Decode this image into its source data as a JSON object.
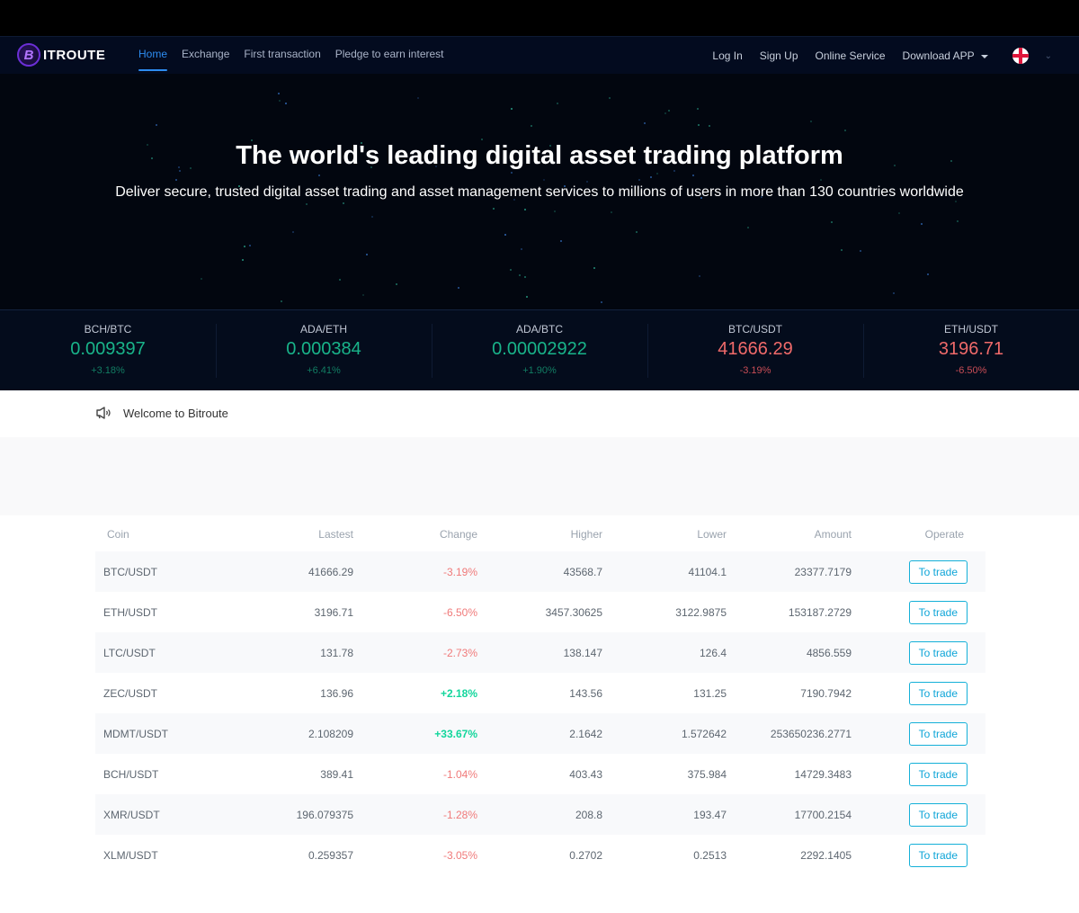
{
  "brand": {
    "logo_letter": "B",
    "name": "ITROUTE"
  },
  "nav": {
    "left": [
      {
        "label": "Home",
        "active": true
      },
      {
        "label": "Exchange",
        "active": false
      },
      {
        "label": "First transaction",
        "active": false
      },
      {
        "label": "Pledge to earn interest",
        "active": false
      }
    ],
    "right": {
      "login": "Log In",
      "signup": "Sign Up",
      "service": "Online Service",
      "download": "Download APP",
      "language_icon": "uk-flag-icon"
    }
  },
  "hero": {
    "title": "The world's leading digital asset trading platform",
    "subtitle": "Deliver secure, trusted digital asset trading and asset management services to millions of users in more than 130 countries worldwide"
  },
  "tickers": [
    {
      "pair": "BCH/BTC",
      "price": "0.009397",
      "change": "+3.18%",
      "direction": "up"
    },
    {
      "pair": "ADA/ETH",
      "price": "0.000384",
      "change": "+6.41%",
      "direction": "up"
    },
    {
      "pair": "ADA/BTC",
      "price": "0.00002922",
      "change": "+1.90%",
      "direction": "up"
    },
    {
      "pair": "BTC/USDT",
      "price": "41666.29",
      "change": "-3.19%",
      "direction": "down"
    },
    {
      "pair": "ETH/USDT",
      "price": "3196.71",
      "change": "-6.50%",
      "direction": "down"
    }
  ],
  "notice": {
    "icon": "megaphone-icon",
    "text": "Welcome to Bitroute"
  },
  "market": {
    "headers": [
      "Coin",
      "Lastest",
      "Change",
      "Higher",
      "Lower",
      "Amount",
      "Operate"
    ],
    "button_label": "To trade",
    "rows": [
      {
        "coin": "BTC/USDT",
        "latest": "41666.29",
        "change": "-3.19%",
        "direction": "down",
        "high": "43568.7",
        "low": "41104.1",
        "amount": "23377.7179"
      },
      {
        "coin": "ETH/USDT",
        "latest": "3196.71",
        "change": "-6.50%",
        "direction": "down",
        "high": "3457.30625",
        "low": "3122.9875",
        "amount": "153187.2729"
      },
      {
        "coin": "LTC/USDT",
        "latest": "131.78",
        "change": "-2.73%",
        "direction": "down",
        "high": "138.147",
        "low": "126.4",
        "amount": "4856.559"
      },
      {
        "coin": "ZEC/USDT",
        "latest": "136.96",
        "change": "+2.18%",
        "direction": "up",
        "high": "143.56",
        "low": "131.25",
        "amount": "7190.7942"
      },
      {
        "coin": "MDMT/USDT",
        "latest": "2.108209",
        "change": "+33.67%",
        "direction": "up",
        "high": "2.1642",
        "low": "1.572642",
        "amount": "253650236.2771"
      },
      {
        "coin": "BCH/USDT",
        "latest": "389.41",
        "change": "-1.04%",
        "direction": "down",
        "high": "403.43",
        "low": "375.984",
        "amount": "14729.3483"
      },
      {
        "coin": "XMR/USDT",
        "latest": "196.079375",
        "change": "-1.28%",
        "direction": "down",
        "high": "208.8",
        "low": "193.47",
        "amount": "17700.2154"
      },
      {
        "coin": "XLM/USDT",
        "latest": "0.259357",
        "change": "-3.05%",
        "direction": "down",
        "high": "0.2702",
        "low": "0.2513",
        "amount": "2292.1405"
      }
    ]
  },
  "colors": {
    "accent": "#2d8cf0",
    "up": "#13d69c",
    "down": "#f07a7a",
    "trade_button": "#0ea5d8"
  }
}
